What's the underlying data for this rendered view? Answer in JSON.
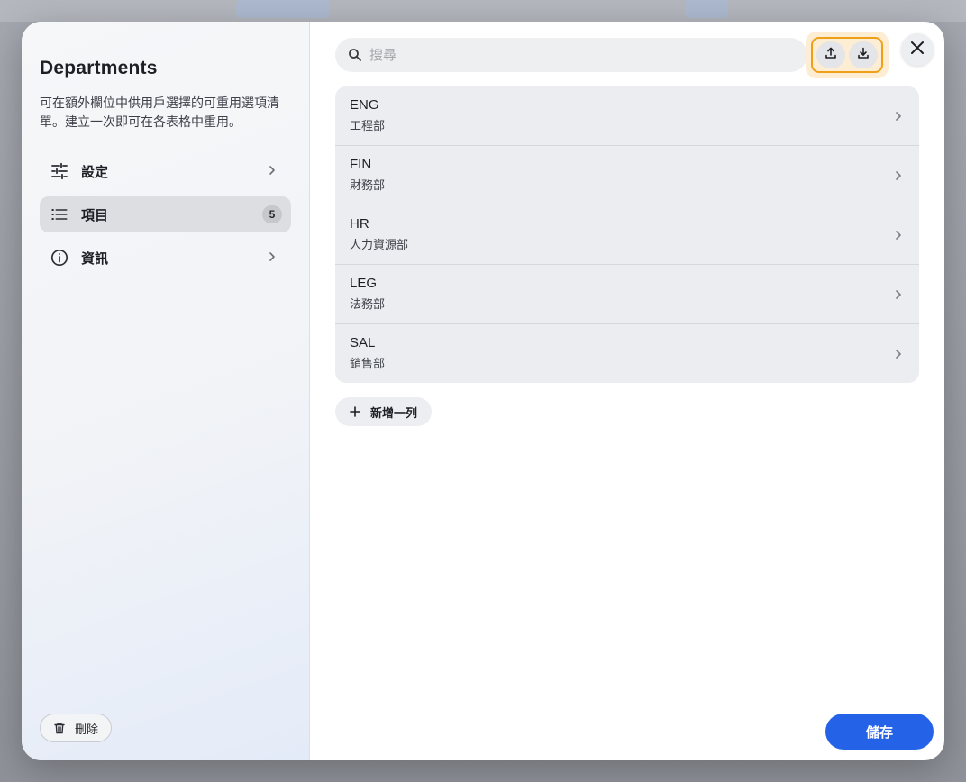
{
  "sidebar": {
    "title": "Departments",
    "description": "可在額外欄位中供用戶選擇的可重用選項清單。建立一次即可在各表格中重用。",
    "nav": [
      {
        "label": "設定",
        "icon": "sliders-icon",
        "badge": ""
      },
      {
        "label": "項目",
        "icon": "list-icon",
        "badge": "5"
      },
      {
        "label": "資訊",
        "icon": "info-icon",
        "badge": ""
      }
    ],
    "delete_label": "刪除"
  },
  "search": {
    "placeholder": "搜尋",
    "value": ""
  },
  "items": [
    {
      "code": "ENG",
      "name": "工程部"
    },
    {
      "code": "FIN",
      "name": "財務部"
    },
    {
      "code": "HR",
      "name": "人力資源部"
    },
    {
      "code": "LEG",
      "name": "法務部"
    },
    {
      "code": "SAL",
      "name": "銷售部"
    }
  ],
  "add_row_label": "新增一列",
  "save_label": "儲存",
  "colors": {
    "primary": "#2462e8",
    "highlight": "#f0a018",
    "highlight_bg": "#fcedd3"
  }
}
